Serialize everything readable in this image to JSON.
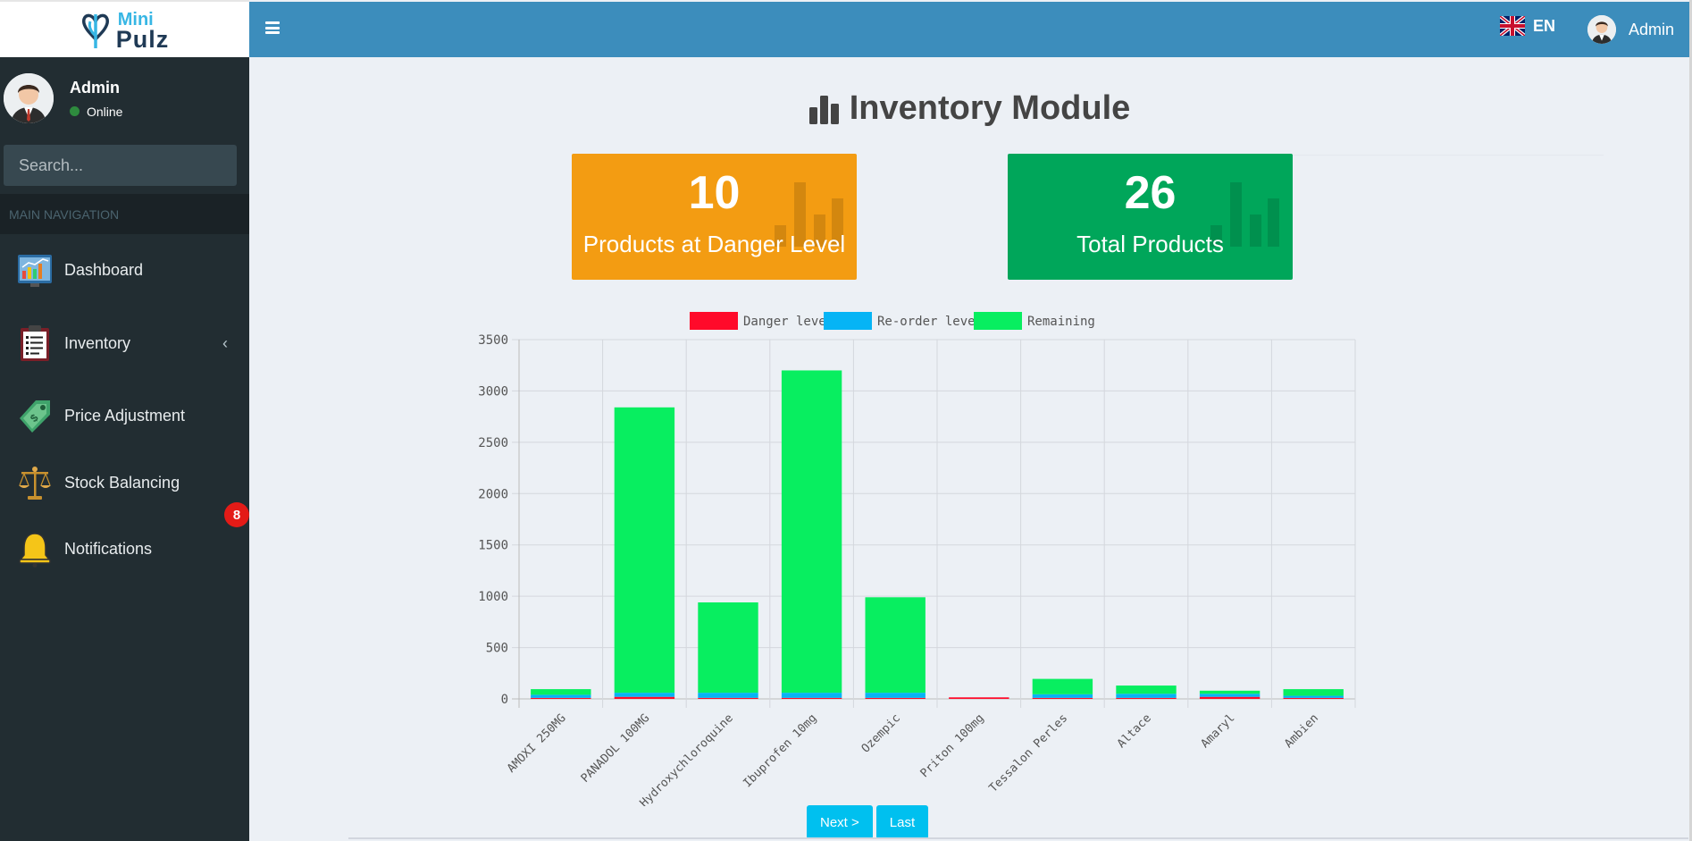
{
  "brand": {
    "line1": "Mini",
    "line2": "Pulz"
  },
  "sidebar": {
    "user": {
      "name": "Admin",
      "status": "Online"
    },
    "search_placeholder": "Search...",
    "nav_header": "MAIN NAVIGATION",
    "items": [
      {
        "label": "Dashboard",
        "icon": "dashboard-chart-icon"
      },
      {
        "label": "Inventory",
        "icon": "clipboard-icon",
        "has_submenu": true
      },
      {
        "label": "Price Adjustment",
        "icon": "price-tag-icon"
      },
      {
        "label": "Stock Balancing",
        "icon": "balance-scale-icon"
      },
      {
        "label": "Notifications",
        "icon": "bell-icon",
        "badge": "8"
      }
    ]
  },
  "topbar": {
    "language": "EN",
    "user": "Admin"
  },
  "page": {
    "title": "Inventory Module"
  },
  "stats": [
    {
      "value": "10",
      "label": "Products at Danger Level",
      "color": "#f39c12"
    },
    {
      "value": "26",
      "label": "Total Products",
      "color": "#00a65a"
    }
  ],
  "chart_data": {
    "type": "bar",
    "stacked": true,
    "categories": [
      "AMOXI 250MG",
      "PANADOL 100MG",
      "Hydroxychloroquine",
      "Ibuprofen 10mg",
      "Ozempic",
      "Priton 100mg",
      "Tessalon Perles",
      "Altace",
      "Amaryl",
      "Ambien"
    ],
    "series": [
      {
        "name": "Danger level",
        "color": "#ff0a2a",
        "values": [
          10,
          20,
          10,
          10,
          10,
          15,
          10,
          10,
          20,
          10
        ]
      },
      {
        "name": "Re-order level",
        "color": "#06b4f5",
        "values": [
          30,
          40,
          50,
          50,
          50,
          0,
          35,
          40,
          30,
          20
        ]
      },
      {
        "name": "Remaining",
        "color": "#08ee60",
        "values": [
          55,
          2780,
          880,
          3140,
          930,
          0,
          150,
          80,
          30,
          65
        ]
      }
    ],
    "ylim": [
      0,
      3500
    ],
    "yticks": [
      0,
      500,
      1000,
      1500,
      2000,
      2500,
      3000,
      3500
    ],
    "legend": "top",
    "grid": true
  },
  "pager": {
    "next": "Next >",
    "last": "Last"
  }
}
